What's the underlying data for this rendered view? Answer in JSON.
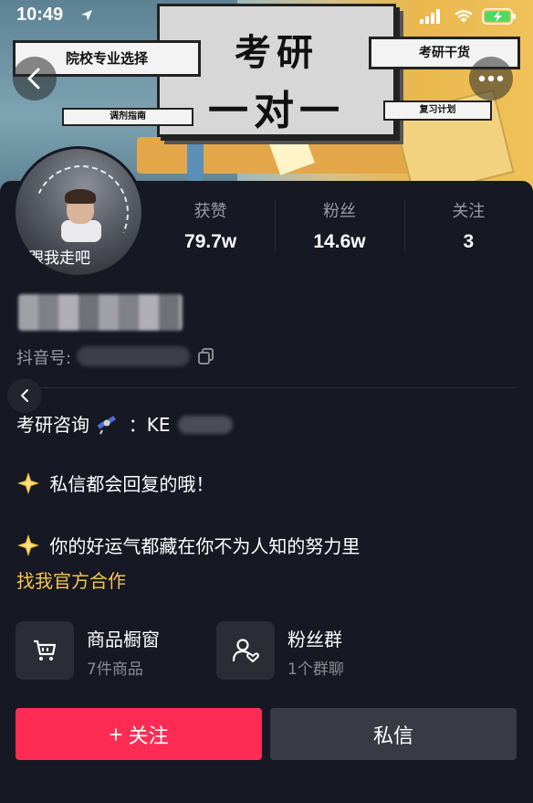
{
  "status_bar": {
    "time": "10:49",
    "icons": [
      "location-arrow-icon",
      "signal-icon",
      "wifi-icon",
      "battery-charging-icon"
    ]
  },
  "banner": {
    "title_line1": "考研",
    "title_line2": "一对一",
    "tag_left": "院校专业选择",
    "tag_right": "考研干货",
    "tag_small_left": "调剂指南",
    "tag_small_right": "复习计划"
  },
  "nav": {
    "back_icon": "chevron-left-icon",
    "more_icon": "more-horizontal-icon"
  },
  "profile": {
    "avatar_text": "跟我走吧",
    "stats": [
      {
        "label": "获赞",
        "value": "79.7w"
      },
      {
        "label": "粉丝",
        "value": "14.6w"
      },
      {
        "label": "关注",
        "value": "3"
      }
    ],
    "douyin_id_label": "抖音号:",
    "bio": {
      "line1_prefix": "考研咨询",
      "line1_suffix": "：KE",
      "line2": "私信都会回复的哦！",
      "line3": "你的好运气都藏在你不为人知的努力里"
    },
    "official_link": "找我官方合作"
  },
  "features": [
    {
      "title": "商品橱窗",
      "subtitle": "7件商品",
      "icon": "shopping-cart-icon"
    },
    {
      "title": "粉丝群",
      "subtitle": "1个群聊",
      "icon": "fan-group-icon"
    }
  ],
  "actions": {
    "follow_plus": "+",
    "follow_label": "关注",
    "message_label": "私信"
  },
  "colors": {
    "background": "#161823",
    "follow_button": "#fe2c55",
    "message_button": "#393b44",
    "official_link": "#f5c64a"
  }
}
